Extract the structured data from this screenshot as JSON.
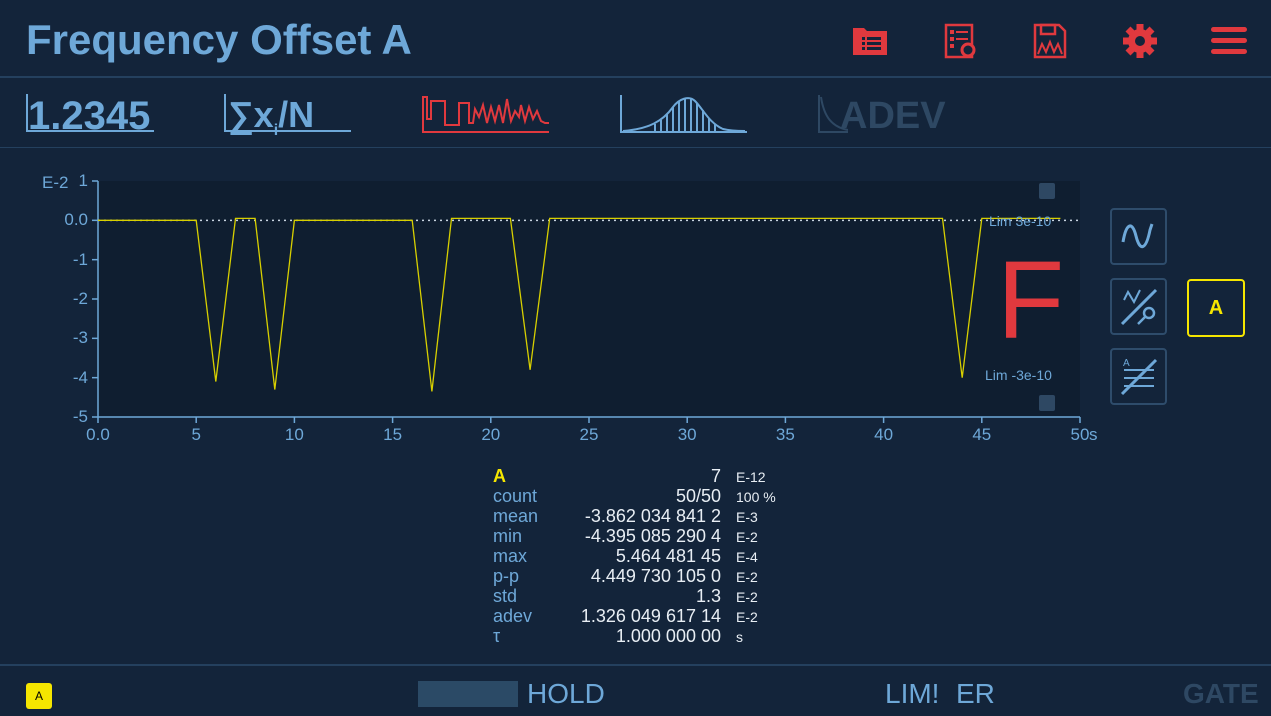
{
  "header": {
    "title": "Frequency Offset A",
    "icons": [
      "folder-list-icon",
      "settings-sheet-icon",
      "save-chart-icon",
      "gear-icon",
      "hamburger-menu-icon"
    ]
  },
  "tabs": {
    "value_label": "1.2345",
    "mean_label_sum": "∑x",
    "mean_label_sub": "i",
    "mean_label_rest": "/N",
    "adev_label": "ADEV"
  },
  "colors": {
    "accent": "#6ea8d8",
    "alert": "#e0393e",
    "trace": "#d8d000",
    "channel": "#f5e600",
    "background": "#13243a"
  },
  "chart_data": {
    "type": "line",
    "ylabel_exp": "E-2",
    "y_ticks": [
      "1",
      "0.0",
      "-1",
      "-2",
      "-3",
      "-4",
      "-5"
    ],
    "x_ticks": [
      "0.0",
      "5",
      "10",
      "15",
      "20",
      "25",
      "30",
      "35",
      "40",
      "45",
      "50"
    ],
    "x_unit": "s",
    "xlim": [
      0,
      50
    ],
    "ylim": [
      -5,
      1
    ],
    "x": [
      0,
      1,
      2,
      3,
      4,
      5,
      6,
      7,
      8,
      9,
      10,
      11,
      12,
      13,
      14,
      15,
      16,
      17,
      18,
      19,
      20,
      21,
      22,
      23,
      24,
      25,
      26,
      27,
      28,
      29,
      30,
      31,
      32,
      33,
      34,
      35,
      36,
      37,
      38,
      39,
      40,
      41,
      42,
      43,
      44,
      45,
      46,
      47,
      48,
      49
    ],
    "y": [
      0,
      0,
      0,
      0,
      0,
      0,
      -4.1,
      0.05,
      0.05,
      -4.3,
      0,
      0,
      0,
      0,
      0,
      0,
      0,
      -4.35,
      0.05,
      0.05,
      0.05,
      0.05,
      -3.8,
      0.05,
      0.05,
      0.05,
      0.05,
      0.05,
      0.05,
      0.05,
      0.05,
      0.05,
      0.05,
      0.05,
      0.05,
      0.05,
      0.05,
      0.05,
      0.05,
      0.05,
      0.05,
      0.05,
      0.05,
      0.05,
      -4.0,
      0.05,
      0.05,
      0.05,
      0.05,
      0.05
    ],
    "limits": {
      "upper_label": "Lim 3e-10",
      "lower_label": "Lim -3e-10"
    },
    "result_mark": "F"
  },
  "side": {
    "channel_label": "A"
  },
  "stats": {
    "header": {
      "label": "A",
      "value": "7",
      "exp": "E-12"
    },
    "rows": [
      {
        "label": "count",
        "value": "50/50",
        "exp": "100 %"
      },
      {
        "label": "mean",
        "value": "-3.862 034 841 2",
        "exp": "E-3"
      },
      {
        "label": "min",
        "value": "-4.395 085 290 4",
        "exp": "E-2"
      },
      {
        "label": "max",
        "value": "5.464 481 45",
        "exp": "E-4"
      },
      {
        "label": "p-p",
        "value": "4.449 730 105 0",
        "exp": "E-2"
      },
      {
        "label": "std",
        "value": "1.3",
        "exp": "E-2"
      },
      {
        "label": "adev",
        "value": "1.326 049 617 14",
        "exp": "E-2"
      },
      {
        "label": "τ",
        "value": "1.000 000 00",
        "exp": "s"
      }
    ]
  },
  "footer": {
    "channel_badge": "A",
    "hold_label": "HOLD",
    "lim_label": "LIM!",
    "er_label": "ER",
    "gate_label": "GATE"
  }
}
